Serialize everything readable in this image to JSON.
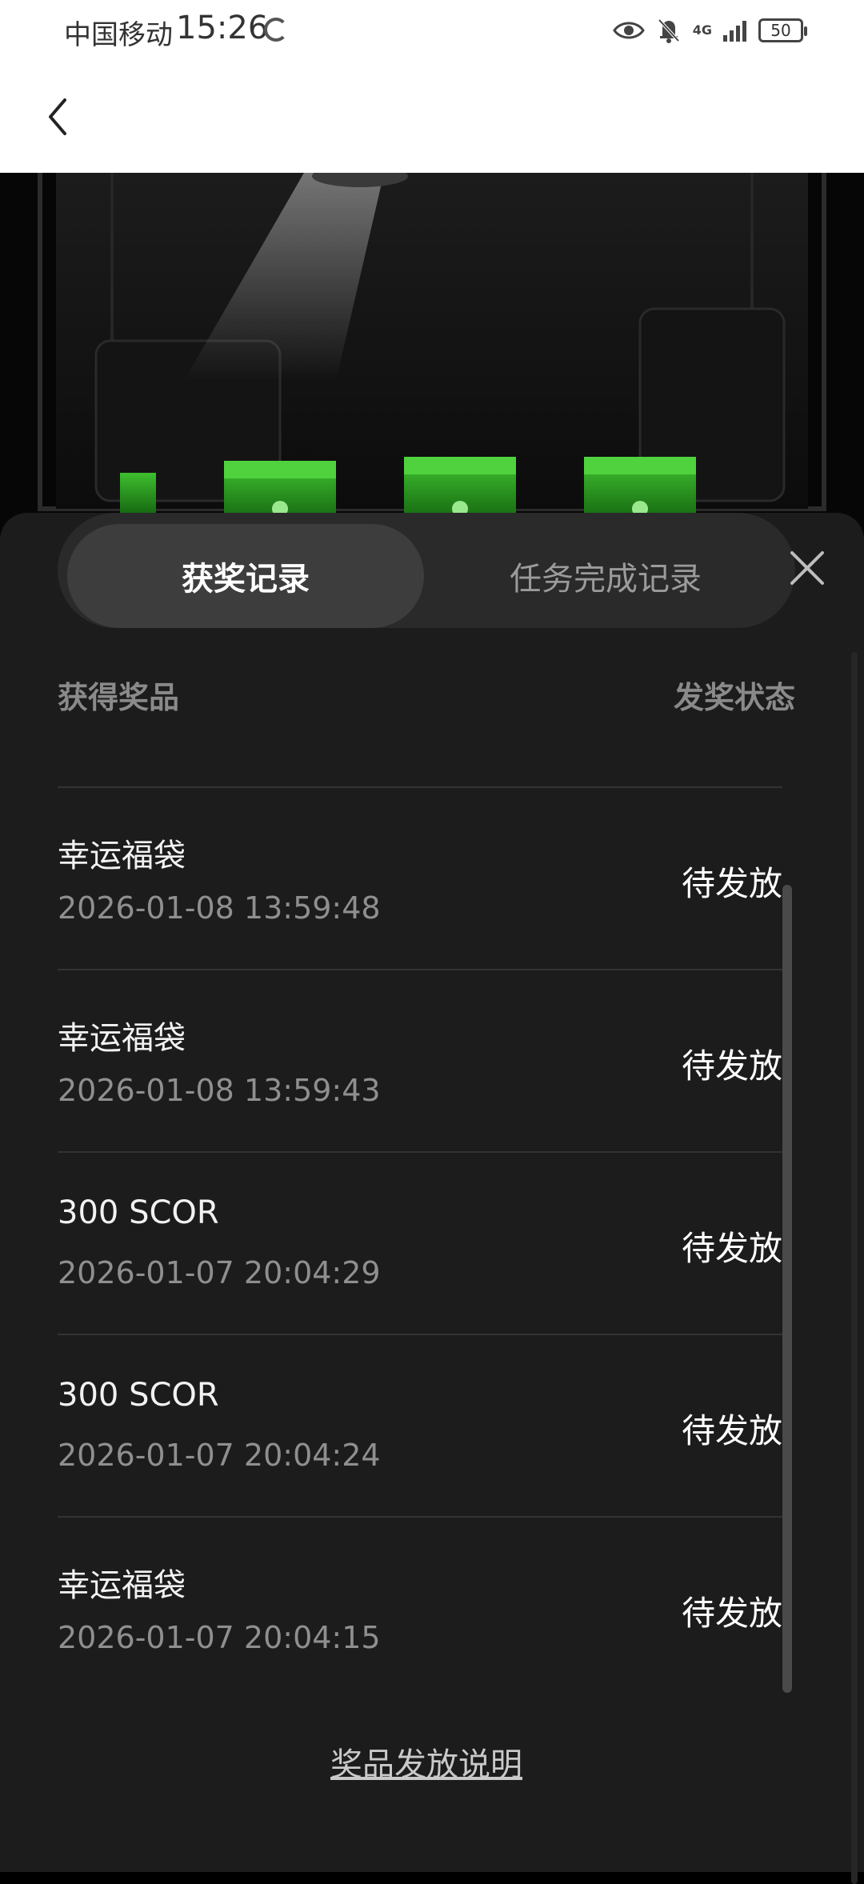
{
  "status_bar": {
    "carrier": "中国移动",
    "time": "15:26",
    "network": "4G",
    "battery": "50"
  },
  "nav": {
    "back_icon": "chevron-left-icon"
  },
  "tabs": [
    {
      "label": "获奖记录",
      "active": true
    },
    {
      "label": "任务完成记录",
      "active": false
    }
  ],
  "table": {
    "col_prize": "获得奖品",
    "col_status": "发奖状态",
    "rows": [
      {
        "name": "幸运福袋",
        "time": "2026-01-08 13:59:48",
        "status": "待发放"
      },
      {
        "name": "幸运福袋",
        "time": "2026-01-08 13:59:43",
        "status": "待发放"
      },
      {
        "name": "300 SCOR",
        "time": "2026-01-07 20:04:29",
        "status": "待发放"
      },
      {
        "name": "300 SCOR",
        "time": "2026-01-07 20:04:24",
        "status": "待发放"
      },
      {
        "name": "幸运福袋",
        "time": "2026-01-07 20:04:15",
        "status": "待发放"
      }
    ]
  },
  "footer": {
    "explain_link": "奖品发放说明"
  },
  "colors": {
    "sheet_bg": "#1c1c1c",
    "tab_active_bg": "#3d3d3d",
    "accent_green": "#2fa32a"
  }
}
